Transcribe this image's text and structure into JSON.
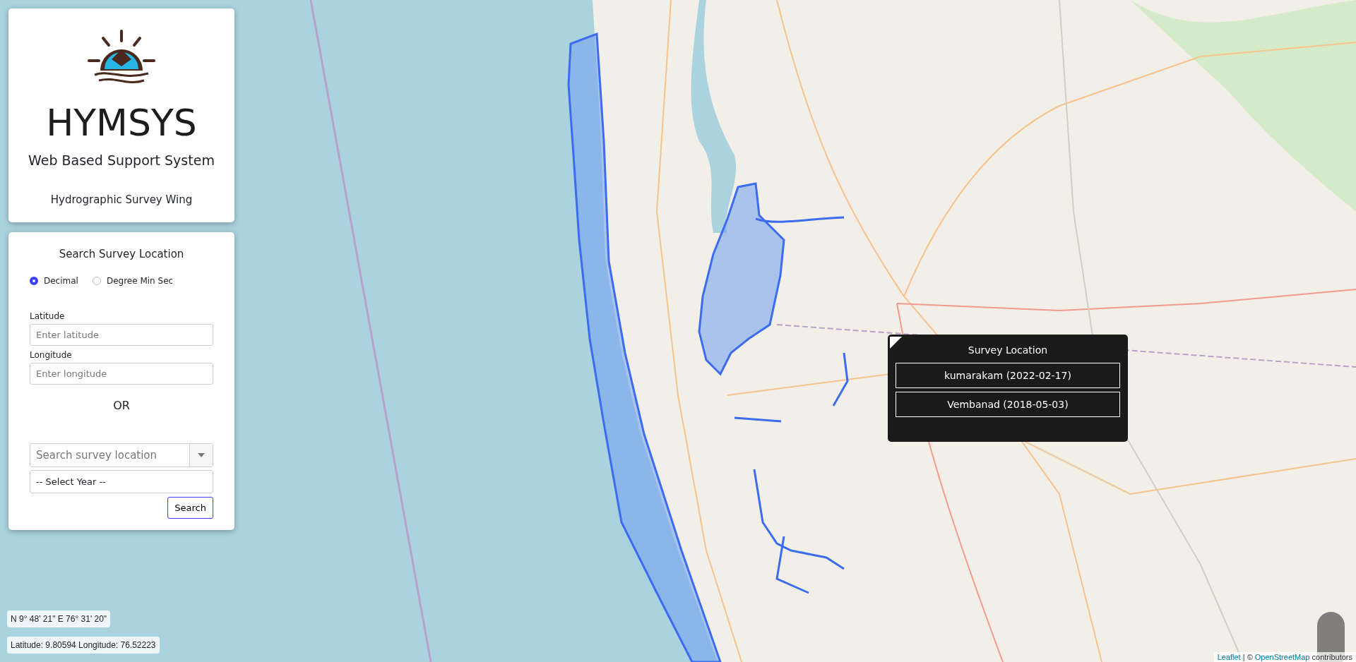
{
  "header": {
    "title": "HYMSYS",
    "subtitle": "Web Based Support System",
    "department": "Hydrographic Survey Wing"
  },
  "search_panel": {
    "title": "Search Survey Location",
    "formats": [
      {
        "label": "Decimal",
        "selected": true
      },
      {
        "label": "Degree Min Sec",
        "selected": false
      }
    ],
    "fields": [
      {
        "label": "Latitude",
        "placeholder": "Enter latitude"
      },
      {
        "label": "Longitude",
        "placeholder": "Enter longitude"
      }
    ],
    "separator": "OR",
    "location_search": {
      "placeholder": "Search survey location"
    },
    "year_select": {
      "value": "-- Select Year --"
    },
    "button": "Search"
  },
  "popup": {
    "title": "Survey Location",
    "items": [
      "kumarakam (2022-02-17)",
      "Vembanad (2018-05-03)"
    ]
  },
  "coordinates": {
    "dms": "N 9° 48' 21\" E 76° 31' 20\"",
    "decimal": "Latitude: 9.80594 Longitude: 76.52223"
  },
  "attribution": {
    "link": "Leaflet",
    "separator": " | © ",
    "source": "OpenStreetMap",
    "suffix": " contributors"
  }
}
